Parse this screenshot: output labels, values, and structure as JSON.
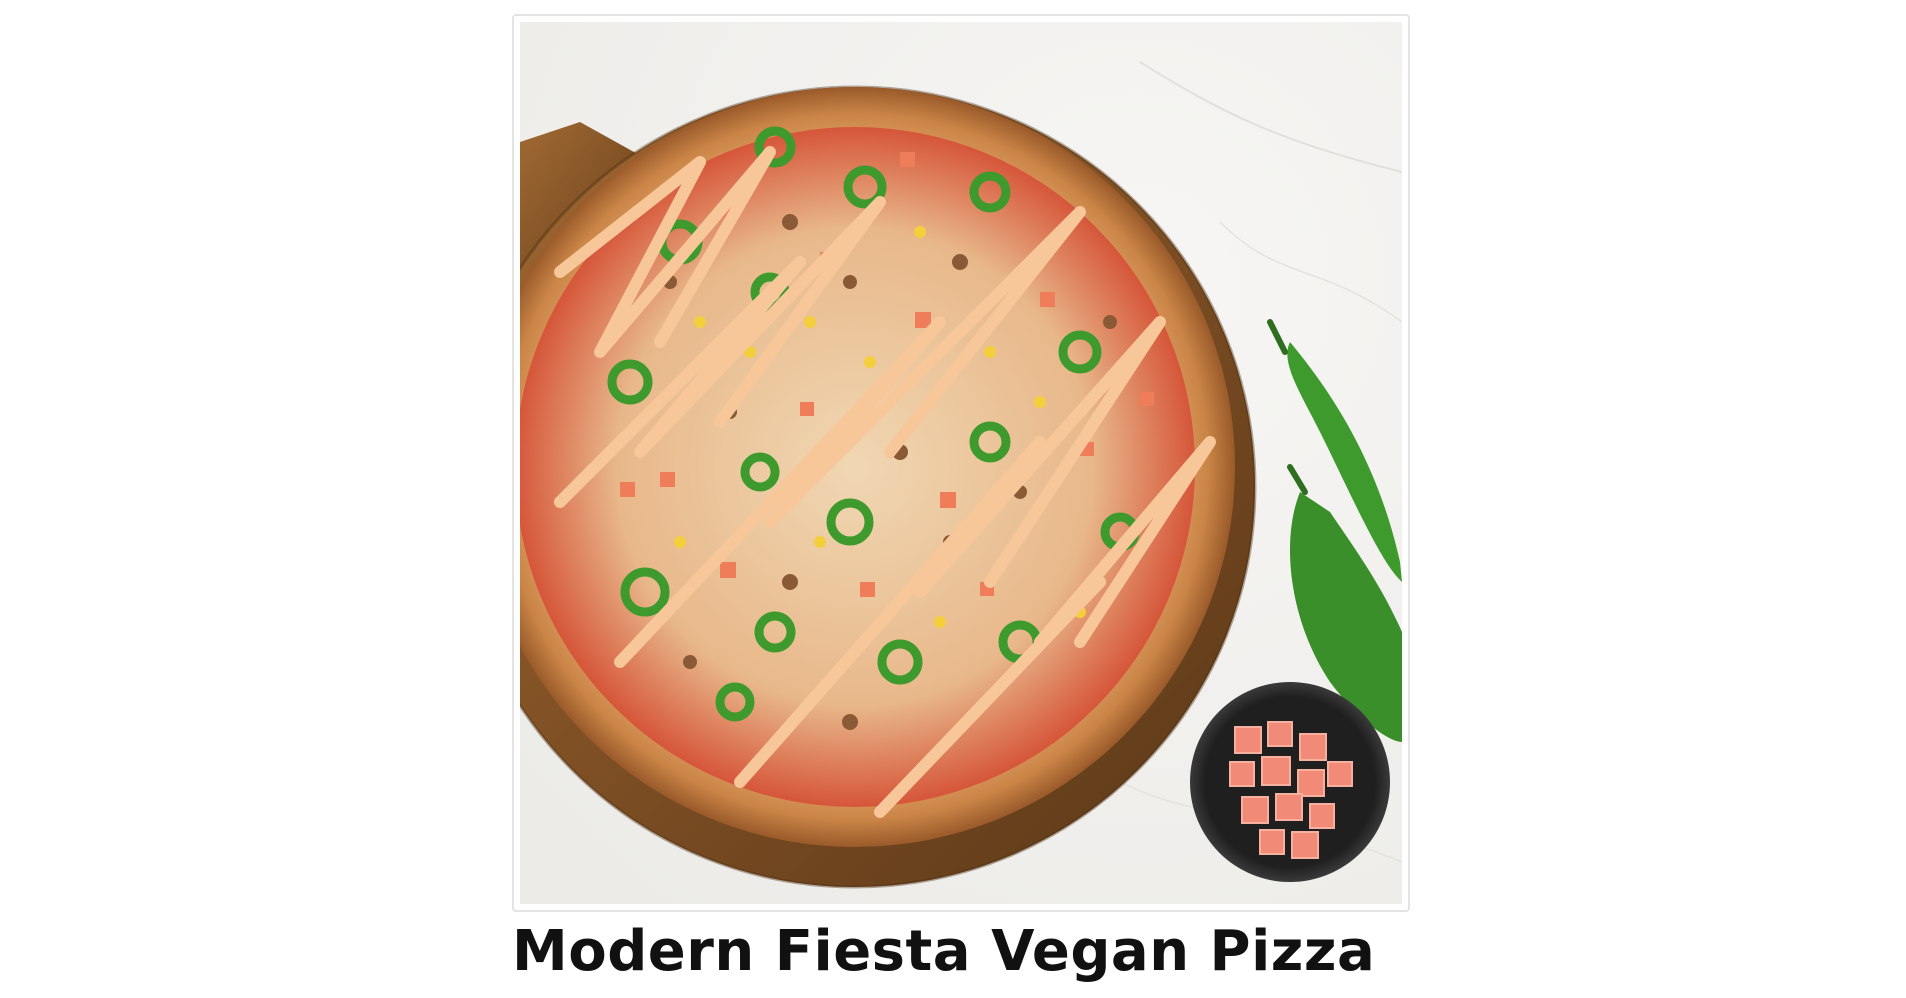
{
  "product": {
    "title": "Modern Fiesta Vegan Pizza",
    "image": {
      "icon": "pizza-photo",
      "depicts": [
        "pizza",
        "wooden-peel",
        "jalapeno-peppers",
        "diced-tomato-bowl"
      ]
    }
  },
  "colors": {
    "title_text": "#111111",
    "card_border": "#e4e4e4",
    "marble_background": "#f2f1ef",
    "crust": "#d99a5c",
    "sauce_drizzle": "#f7c79a",
    "jalapeno": "#3f9a2e",
    "tomato": "#f08a74",
    "wood": "#8b5a2b"
  }
}
